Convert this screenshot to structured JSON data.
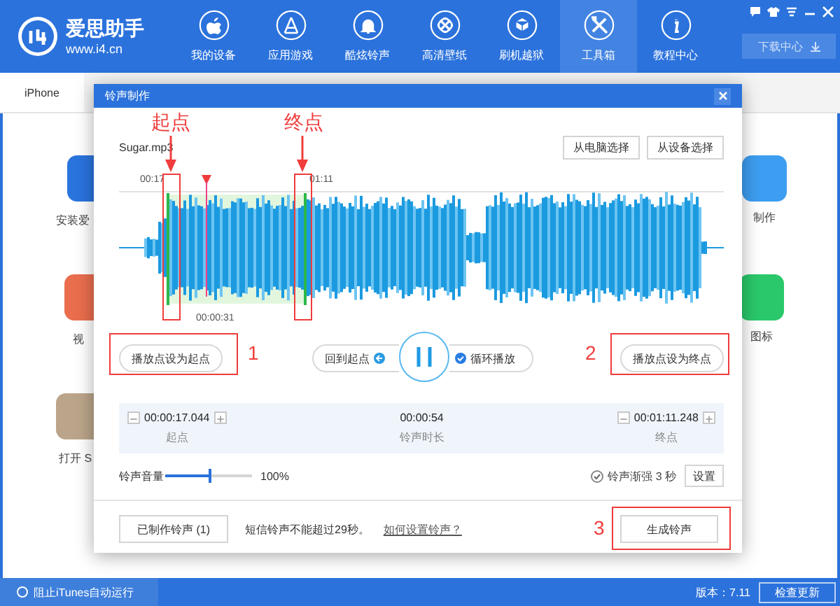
{
  "app": {
    "title": "爱思助手",
    "url": "www.i4.cn"
  },
  "nav": [
    {
      "label": "我的设备",
      "selected": false
    },
    {
      "label": "应用游戏",
      "selected": false
    },
    {
      "label": "酷炫铃声",
      "selected": false
    },
    {
      "label": "高清壁纸",
      "selected": false
    },
    {
      "label": "刷机越狱",
      "selected": false
    },
    {
      "label": "工具箱",
      "selected": true
    },
    {
      "label": "教程中心",
      "selected": false
    }
  ],
  "download_button": "下载中心",
  "tabs": [
    {
      "label": "iPhone",
      "selected": true
    }
  ],
  "tools_left": [
    "安装爱",
    "视",
    "打开 S"
  ],
  "tools_right": [
    "制作",
    "图标"
  ],
  "dialog": {
    "title": "铃声制作",
    "file_name": "Sugar.mp3",
    "source_buttons": [
      "从电脑选择",
      "从设备选择"
    ],
    "waveform": {
      "start_time": "00:17",
      "end_time": "01:11",
      "playhead_time": "00:00:31"
    },
    "set_start_button": "播放点设为起点",
    "back_to_start": "回到起点",
    "playing": true,
    "loop": {
      "label": "循环播放",
      "checked": true
    },
    "set_end_button": "播放点设为终点",
    "start": {
      "value": "00:00:17.044",
      "label": "起点"
    },
    "duration": {
      "value": "00:00:54",
      "label": "铃声时长"
    },
    "end": {
      "value": "00:01:11.248",
      "label": "终点"
    },
    "volume": {
      "label": "铃声音量",
      "level": 0.52,
      "reading": "100%"
    },
    "fade_in": {
      "label": "铃声渐强 3 秒",
      "checked": true
    },
    "settings_button": "设置",
    "made_button": "已制作铃声 (1)",
    "note": "短信铃声不能超过29秒。",
    "help_link": "如何设置铃声？",
    "generate_button": "生成铃声"
  },
  "annotations": {
    "start_label": "起点",
    "end_label": "终点",
    "steps": [
      "1",
      "2",
      "3"
    ]
  },
  "status_bar": {
    "itunes_block": {
      "label": "阻止iTunes自动运行",
      "checked": false
    },
    "version": "版本：7.11",
    "update_button": "检查更新"
  }
}
